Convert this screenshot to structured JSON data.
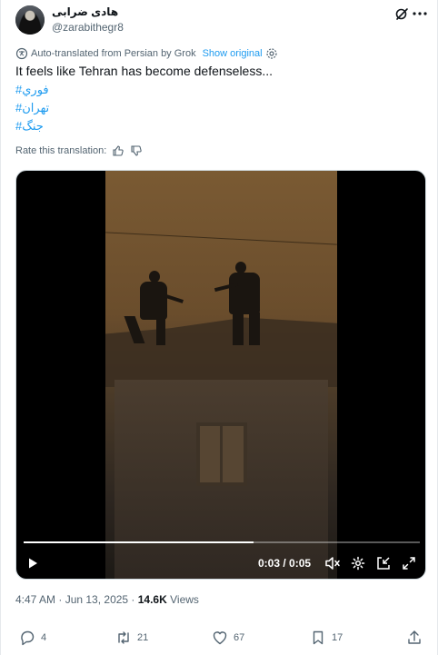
{
  "author": {
    "display_name": "هادی ضرابی",
    "handle": "@zarabithegr8"
  },
  "translation": {
    "notice": "Auto-translated from Persian by Grok",
    "show_original": "Show original"
  },
  "tweet": {
    "text": "It feels like Tehran has become defenseless...",
    "hashtags": [
      "#فوري",
      "#تهران",
      "#جنگ"
    ]
  },
  "rate": {
    "label": "Rate this translation:"
  },
  "video": {
    "time": "0:03 / 0:05",
    "progress": 0.58
  },
  "meta": {
    "timestamp": "4:47 AM · Jun 13, 2025 · ",
    "views_count": "14.6K",
    "views_label": " Views"
  },
  "actions": {
    "replies": "4",
    "reposts": "21",
    "likes": "67",
    "bookmarks": "17"
  },
  "colors": {
    "link": "#1d9bf0",
    "muted": "#536471",
    "text": "#0f1419"
  }
}
